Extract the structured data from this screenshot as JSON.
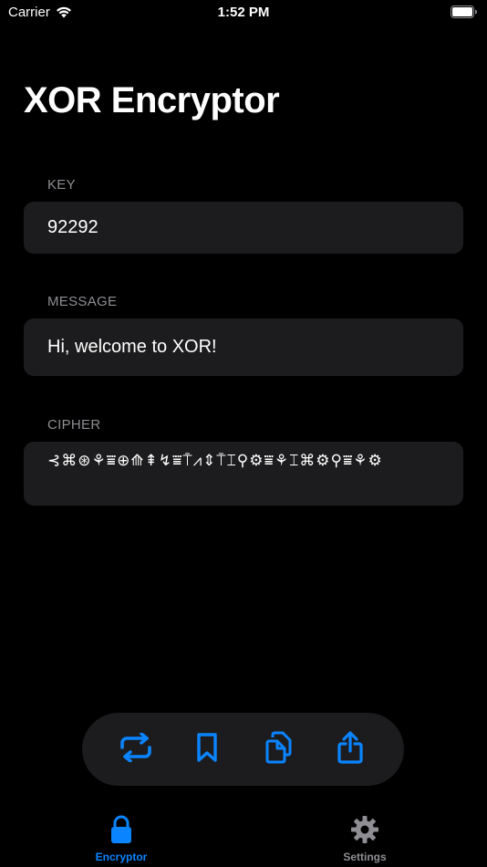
{
  "status_bar": {
    "carrier": "Carrier",
    "time": "1:52 PM"
  },
  "page_title": "XOR Encryptor",
  "key": {
    "label": "KEY",
    "value": "92292"
  },
  "message": {
    "label": "MESSAGE",
    "value": "Hi, welcome to XOR!"
  },
  "cipher": {
    "label": "CIPHER",
    "value": "⊰⌘⊛⚘⩸⊕⟰⇞↯⩸⍑⩘⇕⍑⌶⚲⚙⩸⚘⌶⌘⚙⚲⩸⚘⚙"
  },
  "toolbar": {
    "icons": [
      "swap-icon",
      "bookmark-icon",
      "copy-icon",
      "share-icon"
    ]
  },
  "tab_bar": {
    "tabs": [
      {
        "label": "Encryptor",
        "icon": "lock-icon",
        "active": true
      },
      {
        "label": "Settings",
        "icon": "gear-icon",
        "active": false
      }
    ]
  },
  "colors": {
    "accent": "#0a84ff",
    "background": "#000000",
    "field_background": "#1c1c1e",
    "secondary_text": "#8e8e93",
    "inactive_tab": "#8e8e93"
  }
}
